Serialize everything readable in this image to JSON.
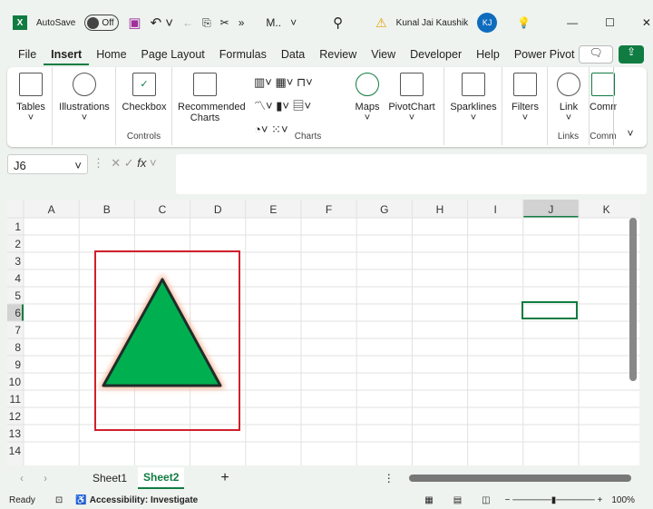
{
  "title": {
    "autosave": "AutoSave",
    "toggle": "Off",
    "filename": "M..",
    "more": "»",
    "user": "Kunal Jai Kaushik",
    "initials": "KJ"
  },
  "menu": [
    "File",
    "Insert",
    "Home",
    "Page Layout",
    "Formulas",
    "Data",
    "Review",
    "View",
    "Developer",
    "Help",
    "Power Pivot"
  ],
  "ribbon": {
    "tables": "Tables",
    "illustrations": "Illustrations",
    "checkbox": "Checkbox",
    "controls": "Controls",
    "recommended": "Recommended",
    "charts_word": "Charts",
    "charts_group": "Charts",
    "maps": "Maps",
    "pivotchart": "PivotChart",
    "sparklines": "Sparklines",
    "filters": "Filters",
    "link": "Link",
    "links": "Links",
    "comment": "Comm",
    "comments": "Comm"
  },
  "formula": {
    "namebox": "J6",
    "fx": "fx",
    "value": ""
  },
  "columns": [
    "A",
    "B",
    "C",
    "D",
    "E",
    "F",
    "G",
    "H",
    "I",
    "J",
    "K"
  ],
  "rows": [
    "1",
    "2",
    "3",
    "4",
    "5",
    "6",
    "7",
    "8",
    "9",
    "10",
    "11",
    "12",
    "13",
    "14"
  ],
  "active_cell": "J6",
  "sheets": [
    "Sheet1",
    "Sheet2"
  ],
  "active_sheet": "Sheet2",
  "status": {
    "ready": "Ready",
    "accessibility": "Accessibility: Investigate",
    "zoom": "100%"
  },
  "colors": {
    "accent": "#107c41",
    "shape_fill": "#00b050",
    "shape_border": "#1f2d2a",
    "frame": "#d0202a"
  }
}
